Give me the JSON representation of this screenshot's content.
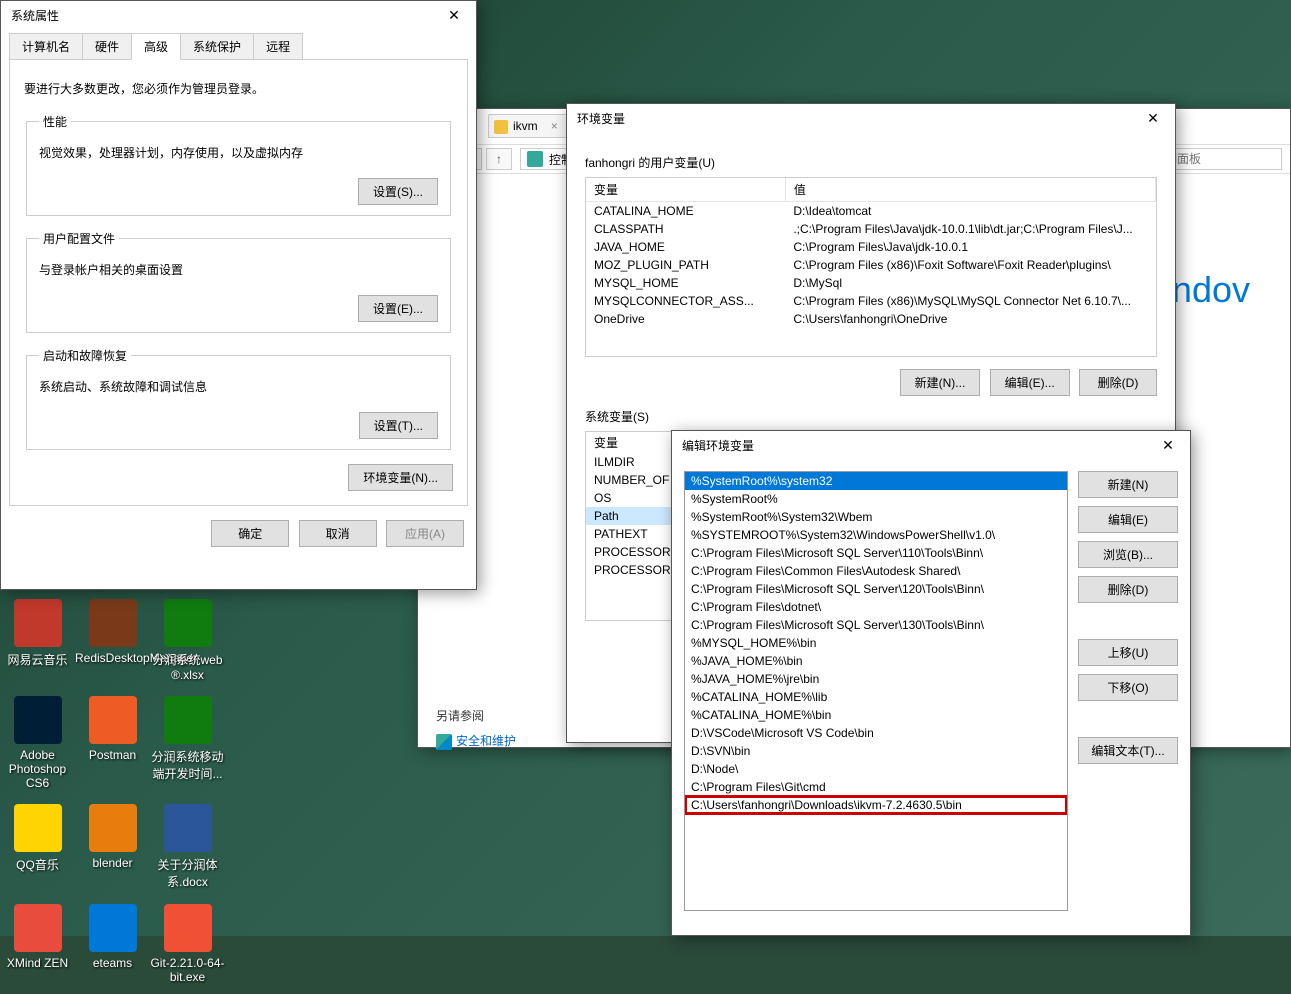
{
  "desktop": [
    {
      "label": "网易云音乐",
      "color": "#c0392b"
    },
    {
      "label": "RedisDesktopManager",
      "color": "#7a3a1a"
    },
    {
      "label": "分润系统web ®.xlsx",
      "color": "#107c10"
    },
    {
      "label": "Adobe Photoshop CS6",
      "color": "#001e36"
    },
    {
      "label": "Postman",
      "color": "#ef5b25"
    },
    {
      "label": "分润系统移动端开发时间...",
      "color": "#107c10"
    },
    {
      "label": "QQ音乐",
      "color": "#ffd400"
    },
    {
      "label": "blender",
      "color": "#e87d0d"
    },
    {
      "label": "关于分润体系.docx",
      "color": "#2b579a"
    },
    {
      "label": "XMind ZEN",
      "color": "#e74c3c"
    },
    {
      "label": "eteams",
      "color": "#0078d7"
    },
    {
      "label": "Git-2.21.0-64-bit.exe",
      "color": "#f05033"
    }
  ],
  "sysprops": {
    "title": "系统属性",
    "tabs": [
      "计算机名",
      "硬件",
      "高级",
      "系统保护",
      "远程"
    ],
    "active_tab": "高级",
    "note": "要进行大多数更改，您必须作为管理员登录。",
    "perf": {
      "legend": "性能",
      "desc": "视觉效果，处理器计划，内存使用，以及虚拟内存",
      "btn": "设置(S)..."
    },
    "profile": {
      "legend": "用户配置文件",
      "desc": "与登录帐户相关的桌面设置",
      "btn": "设置(E)..."
    },
    "startup": {
      "legend": "启动和故障恢复",
      "desc": "系统启动、系统故障和调试信息",
      "btn": "设置(T)..."
    },
    "env_btn": "环境变量(N)...",
    "ok": "确定",
    "cancel": "取消",
    "apply": "应用(A)"
  },
  "ctrlpanel": {
    "tab": "ikvm",
    "breadcrumb": "控制面板",
    "search_ph": "搜索控制面板",
    "side_hdr": "另请参阅",
    "side_link": "安全和维护",
    "body": "indov"
  },
  "envvars": {
    "title": "环境变量",
    "user_label": "fanhongri 的用户变量(U)",
    "th_var": "变量",
    "th_val": "值",
    "user": [
      {
        "k": "CATALINA_HOME",
        "v": "D:\\Idea\\tomcat"
      },
      {
        "k": "CLASSPATH",
        "v": ".;C:\\Program Files\\Java\\jdk-10.0.1\\lib\\dt.jar;C:\\Program Files\\J..."
      },
      {
        "k": "JAVA_HOME",
        "v": "C:\\Program Files\\Java\\jdk-10.0.1"
      },
      {
        "k": "MOZ_PLUGIN_PATH",
        "v": "C:\\Program Files (x86)\\Foxit Software\\Foxit Reader\\plugins\\"
      },
      {
        "k": "MYSQL_HOME",
        "v": "D:\\MySql"
      },
      {
        "k": "MYSQLCONNECTOR_ASS...",
        "v": "C:\\Program Files (x86)\\MySQL\\MySQL Connector Net 6.10.7\\..."
      },
      {
        "k": "OneDrive",
        "v": "C:\\Users\\fanhongri\\OneDrive"
      }
    ],
    "sys_label": "系统变量(S)",
    "sys": [
      {
        "k": "变量",
        "v": ""
      },
      {
        "k": "ILMDIR",
        "v": ""
      },
      {
        "k": "NUMBER_OF",
        "v": ""
      },
      {
        "k": "OS",
        "v": ""
      },
      {
        "k": "Path",
        "v": "",
        "sel": true
      },
      {
        "k": "PATHEXT",
        "v": ""
      },
      {
        "k": "PROCESSOR",
        "v": ""
      },
      {
        "k": "PROCESSOR",
        "v": ""
      }
    ],
    "new": "新建(N)...",
    "edit": "编辑(E)...",
    "del": "删除(D)"
  },
  "editpath": {
    "title": "编辑环境变量",
    "items": [
      {
        "v": "%SystemRoot%\\system32",
        "sel": true
      },
      {
        "v": "%SystemRoot%"
      },
      {
        "v": "%SystemRoot%\\System32\\Wbem"
      },
      {
        "v": "%SYSTEMROOT%\\System32\\WindowsPowerShell\\v1.0\\"
      },
      {
        "v": "C:\\Program Files\\Microsoft SQL Server\\110\\Tools\\Binn\\"
      },
      {
        "v": "C:\\Program Files\\Common Files\\Autodesk Shared\\"
      },
      {
        "v": "C:\\Program Files\\Microsoft SQL Server\\120\\Tools\\Binn\\"
      },
      {
        "v": "C:\\Program Files\\dotnet\\"
      },
      {
        "v": "C:\\Program Files\\Microsoft SQL Server\\130\\Tools\\Binn\\"
      },
      {
        "v": "%MYSQL_HOME%\\bin"
      },
      {
        "v": "%JAVA_HOME%\\bin"
      },
      {
        "v": "%JAVA_HOME%\\jre\\bin"
      },
      {
        "v": "%CATALINA_HOME%\\lib"
      },
      {
        "v": "%CATALINA_HOME%\\bin"
      },
      {
        "v": "D:\\VSCode\\Microsoft VS Code\\bin"
      },
      {
        "v": "D:\\SVN\\bin"
      },
      {
        "v": "D:\\Node\\"
      },
      {
        "v": "C:\\Program Files\\Git\\cmd"
      },
      {
        "v": "C:\\Users\\fanhongri\\Downloads\\ikvm-7.2.4630.5\\bin",
        "hl": true
      }
    ],
    "btns": {
      "new": "新建(N)",
      "edit": "编辑(E)",
      "browse": "浏览(B)...",
      "del": "删除(D)",
      "up": "上移(U)",
      "down": "下移(O)",
      "txt": "编辑文本(T)..."
    }
  }
}
